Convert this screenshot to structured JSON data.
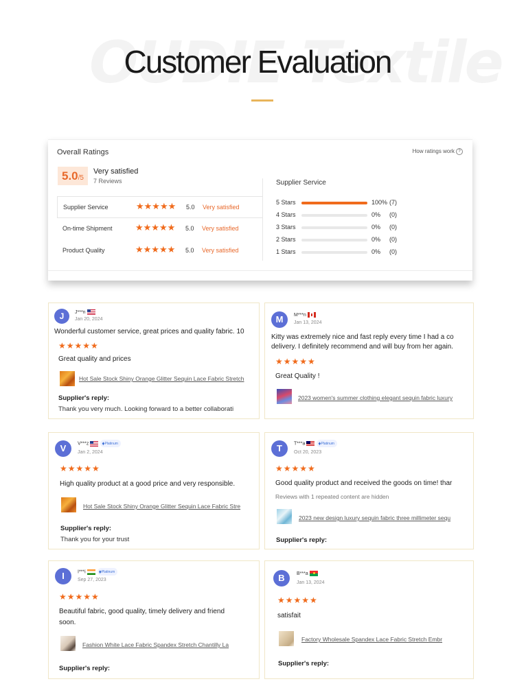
{
  "header": {
    "watermark": "OUDIE Textile",
    "title": "Customer Evaluation"
  },
  "overall": {
    "title": "Overall Ratings",
    "how_link": "How ratings work",
    "score": "5.0",
    "score_suffix": "/5",
    "verdict": "Very satisfied",
    "reviews": "7 Reviews",
    "categories": [
      {
        "name": "Supplier Service",
        "stars": "★★★★★",
        "value": "5.0",
        "label": "Very satisfied"
      },
      {
        "name": "On-time Shipment",
        "stars": "★★★★★",
        "value": "5.0",
        "label": "Very satisfied"
      },
      {
        "name": "Product Quality",
        "stars": "★★★★★",
        "value": "5.0",
        "label": "Very satisfied"
      }
    ],
    "service": {
      "title": "Supplier Service",
      "rows": [
        {
          "stars": "5 Stars",
          "pct": "100%",
          "count": "(7)",
          "fill": 1.0
        },
        {
          "stars": "4 Stars",
          "pct": "0%",
          "count": "(0)",
          "fill": 0
        },
        {
          "stars": "3 Stars",
          "pct": "0%",
          "count": "(0)",
          "fill": 0
        },
        {
          "stars": "2 Stars",
          "pct": "0%",
          "count": "(0)",
          "fill": 0
        },
        {
          "stars": "1 Stars",
          "pct": "0%",
          "count": "(0)",
          "fill": 0
        }
      ]
    },
    "accent_color": "#f06b1c"
  },
  "reviews": [
    {
      "initial": "J",
      "name": "J***n",
      "country": "us-flag",
      "date": "Jan 20, 2024",
      "text": "Wonderful customer service, great prices and quality fabric. 10",
      "stars": "★★★★★",
      "comment": "Great quality and prices",
      "product": "Hot Sale Stock Shiny Orange Glitter Sequin Lace Fabric Stretch",
      "reply_heading": "Supplier's reply:",
      "reply": "Thank you very much. Looking forward to a better collaborati"
    },
    {
      "initial": "M",
      "name": "M***n",
      "country": "ca-flag",
      "date": "Jan 13, 2024",
      "text_line1": "Kitty was extremely nice and fast reply every time I had a co",
      "text_line2": "delivery. I definitely recommend and will buy from her again.",
      "stars": "★★★★★",
      "comment": "Great Quality !",
      "product": "2023 women's summer clothing elegant sequin fabric luxury"
    },
    {
      "initial": "V",
      "name": "V***z",
      "country": "us-flag",
      "badge": "Platinum",
      "date": "Jan 2, 2024",
      "stars": "★★★★★",
      "text": "High quality product at a good price and very responsible.",
      "product": "Hot Sale Stock Shiny Orange Glitter Sequin Lace Fabric Stre",
      "reply_heading": "Supplier's reply:",
      "reply": "Thank you for your trust"
    },
    {
      "initial": "T",
      "name": "T***a",
      "country": "my-flag",
      "badge": "Platinum",
      "date": "Oct 20, 2023",
      "stars": "★★★★★",
      "text": "Good quality product and received the goods on time! thar",
      "note": "Reviews with 1 repeated content are hidden",
      "product": "2023 new design luxury sequin fabric three millimeter sequ",
      "reply_heading": "Supplier's reply:"
    },
    {
      "initial": "I",
      "name": "I***i",
      "country": "in-flag",
      "badge": "Platinum",
      "date": "Sep 27, 2023",
      "stars": "★★★★★",
      "text_line1": "Beautiful fabric, good quality, timely delivery and friend",
      "text_line2": "soon.",
      "product": "Fashion White Lace Fabric Spandex Stretch Chantilly La",
      "reply_heading": "Supplier's reply:"
    },
    {
      "initial": "B",
      "name": "B***a",
      "country": "bf-flag",
      "date": "Jan 13, 2024",
      "stars": "★★★★★",
      "text": "satisfait",
      "product": "Factory Wholesale Spandex Lace Fabric Stretch Embr",
      "reply_heading": "Supplier's reply:"
    }
  ]
}
